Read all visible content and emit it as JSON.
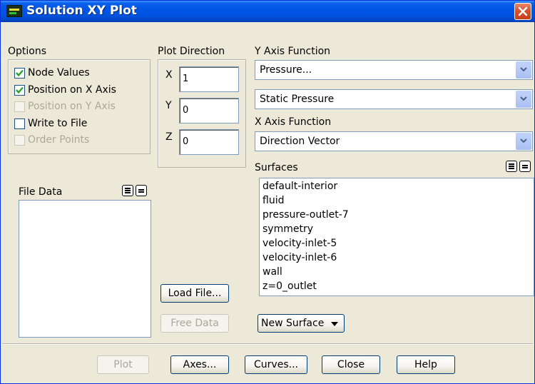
{
  "window": {
    "title": "Solution XY Plot"
  },
  "options": {
    "label": "Options",
    "items": [
      {
        "label": "Node Values",
        "checked": true,
        "enabled": true
      },
      {
        "label": "Position on X Axis",
        "checked": true,
        "enabled": true
      },
      {
        "label": "Position on Y Axis",
        "checked": false,
        "enabled": false
      },
      {
        "label": "Write to File",
        "checked": false,
        "enabled": true
      },
      {
        "label": "Order Points",
        "checked": false,
        "enabled": false
      }
    ]
  },
  "plot_direction": {
    "label": "Plot Direction",
    "axes": [
      {
        "label": "X",
        "value": "1"
      },
      {
        "label": "Y",
        "value": "0"
      },
      {
        "label": "Z",
        "value": "0"
      }
    ]
  },
  "y_axis_function": {
    "label": "Y Axis Function",
    "primary": "Pressure...",
    "secondary": "Static Pressure"
  },
  "x_axis_function": {
    "label": "X Axis Function",
    "value": "Direction Vector"
  },
  "file_data": {
    "label": "File Data",
    "items": []
  },
  "surfaces": {
    "label": "Surfaces",
    "items": [
      "default-interior",
      "fluid",
      "pressure-outlet-7",
      "symmetry",
      "velocity-inlet-5",
      "velocity-inlet-6",
      "wall",
      "z=0_outlet"
    ]
  },
  "buttons": {
    "load_file": "Load File...",
    "free_data": "Free Data",
    "new_surface": "New Surface",
    "plot": "Plot",
    "axes": "Axes...",
    "curves": "Curves...",
    "close": "Close",
    "help": "Help"
  },
  "colors": {
    "title_bar": "#0055E5",
    "dialog_bg": "#ECE9D8",
    "close_button": "#D8512C",
    "check_mark": "#21A121"
  }
}
